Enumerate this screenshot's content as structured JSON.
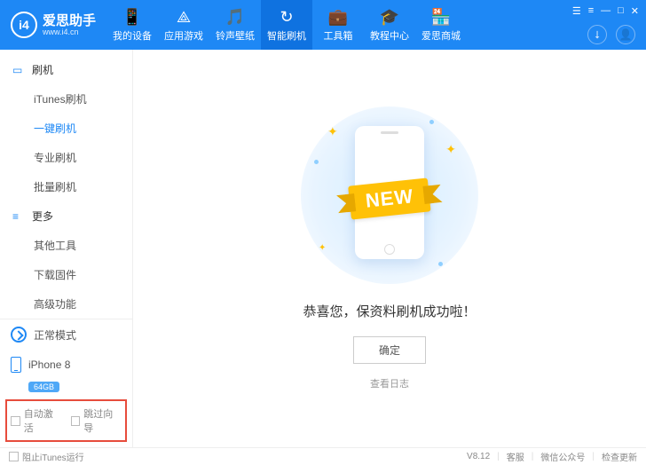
{
  "logo": {
    "badge": "i4",
    "name": "爱思助手",
    "url": "www.i4.cn"
  },
  "nav": [
    {
      "icon": "📱",
      "label": "我的设备"
    },
    {
      "icon": "⟁",
      "label": "应用游戏"
    },
    {
      "icon": "🎵",
      "label": "铃声壁纸"
    },
    {
      "icon": "↻",
      "label": "智能刷机"
    },
    {
      "icon": "💼",
      "label": "工具箱"
    },
    {
      "icon": "🎓",
      "label": "教程中心"
    },
    {
      "icon": "🏪",
      "label": "爱思商城"
    }
  ],
  "winctl": [
    "☰",
    "≡",
    "—",
    "□",
    "✕"
  ],
  "sidebar": {
    "g1": {
      "title": "刷机",
      "items": [
        "iTunes刷机",
        "一键刷机",
        "专业刷机",
        "批量刷机"
      ]
    },
    "g2": {
      "title": "更多",
      "items": [
        "其他工具",
        "下载固件",
        "高级功能"
      ]
    },
    "mode": "正常模式",
    "device": "iPhone 8",
    "storage": "64GB",
    "chk1": "自动激活",
    "chk2": "跳过向导"
  },
  "main": {
    "ribbon": "NEW",
    "message": "恭喜您，保资料刷机成功啦！",
    "ok": "确定",
    "log": "查看日志"
  },
  "footer": {
    "block": "阻止iTunes运行",
    "version": "V8.12",
    "support": "客服",
    "wechat": "微信公众号",
    "update": "检查更新"
  }
}
